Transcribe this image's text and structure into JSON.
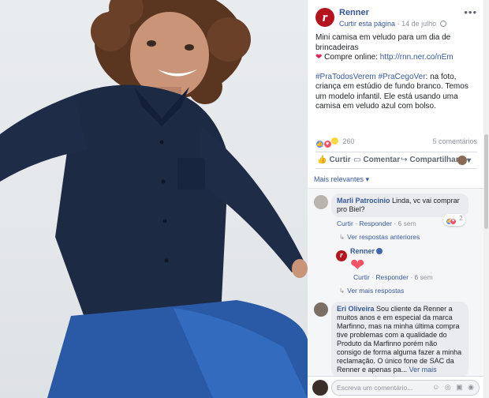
{
  "post": {
    "page_name": "Renner",
    "avatar_letter": "r",
    "follow_label": "Curtir esta página",
    "date": "14 de julho",
    "more": "•••",
    "text_line1": "Mini camisa em veludo para um dia de brincadeiras",
    "heart": "❤",
    "text_buy": "Compre online:",
    "link": "http://rnn.ner.co/nEm",
    "tags": "#PraTodosVerem #PraCegoVer",
    "desc": ": na foto, criança em estúdio de fundo branco. Temos um modelo infantil. Ele está usando uma camisa em veludo azul com bolso.",
    "reaction_count": "260",
    "comments_count": "5 comentários",
    "actions": {
      "like": "Curtir",
      "comment": "Comentar",
      "share": "Compartilhar",
      "react_caret": "▾"
    }
  },
  "comments_section": {
    "filter_label": "Mais relevantes ▾",
    "comment1": {
      "author": "Marli Patrocinio",
      "text": "Linda, vc vai comprar pro Biel?",
      "like": "Curtir",
      "reply": "Responder",
      "time": "6 sem",
      "reaction_count": "2",
      "prev_replies": "Ver respostas anteriores"
    },
    "reply1": {
      "author": "Renner",
      "heart": "❤",
      "like": "Curtir",
      "reply": "Responder",
      "time": "6 sem",
      "more_replies": "Ver mais respostas"
    },
    "comment2": {
      "author": "Eri Oliveira",
      "text": "Sou cliente da Renner a muitos anos e em especial da marca Marfinno, mas na minha última compra tive problemas com a qualidade do Produto da Marfinno porém não consigo de forma alguma fazer a minha reclamação. O único fone de SAC da Renner e apenas pa...",
      "see_more": "Ver mais",
      "actions": "Curtir · Responder · 6 sem"
    },
    "write_placeholder": "Escreva um comentário...",
    "write_icons": "☺ ◎ ▣ ◉"
  },
  "colors": {
    "accent": "#385898",
    "brand": "#b3141e",
    "shirt": "#1d2a44",
    "jeans": "#2a5aa6",
    "heart": "#f25268"
  },
  "icons": [
    "renner-logo",
    "globe-icon",
    "like-icon",
    "comment-icon",
    "share-icon",
    "heart-icon",
    "verified-icon",
    "emoji-icon",
    "camera-icon",
    "gif-icon",
    "sticker-icon"
  ]
}
